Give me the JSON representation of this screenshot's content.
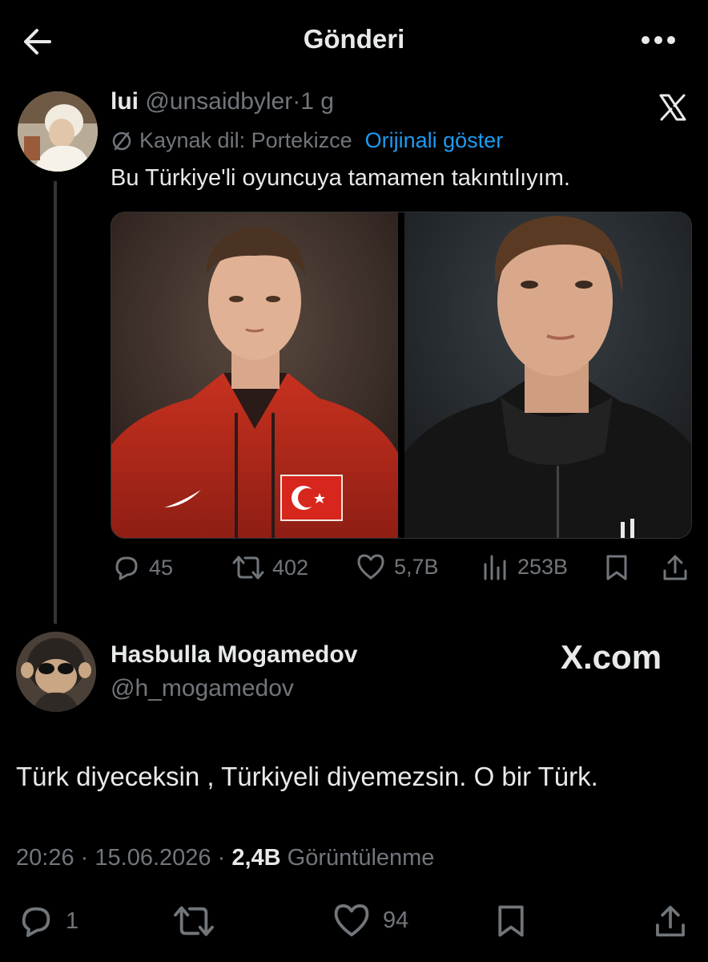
{
  "header": {
    "title": "Gönderi",
    "back_icon": "arrow-left-icon",
    "more_icon": "more-horizontal-icon"
  },
  "quoted_post": {
    "display_name": "lui",
    "handle": "@unsaidbyler",
    "separator": "·",
    "time_ago": "1 g",
    "source_language_label": "Kaynak dil: Portekizce",
    "show_original_label": "Orijinali göster",
    "text": "Bu Türkiye'li oyuncuya tamamen takıntılıyım.",
    "stats": {
      "replies": "45",
      "reposts": "402",
      "likes": "5,7B",
      "views": "253B"
    }
  },
  "reply_post": {
    "display_name": "Hasbulla Mogamedov",
    "handle": "@h_mogamedov",
    "watermark": "X.com",
    "text": "Türk diyeceksin , Türkiyeli diyemezsin. O bir Türk.",
    "time": "20:26",
    "date": "15.06.2026",
    "separator": "·",
    "views_count": "2,4B",
    "views_label": "Görüntülenme",
    "stats": {
      "replies": "1",
      "likes": "94"
    }
  },
  "colors": {
    "background": "#000000",
    "text_primary": "#e7e9ea",
    "text_secondary": "#71767b",
    "link": "#1d9bf0",
    "divider": "#333639"
  }
}
